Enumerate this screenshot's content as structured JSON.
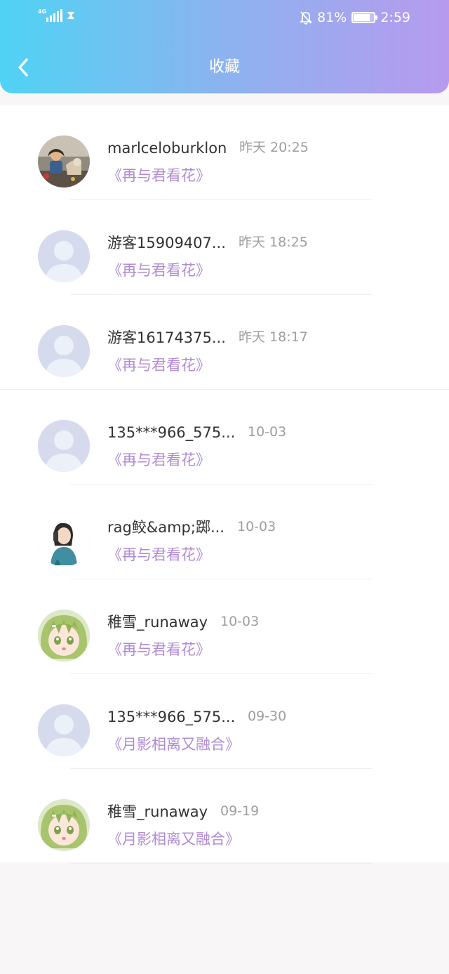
{
  "status_bar": {
    "network": "4G",
    "battery_percent": "81%",
    "battery_level": 0.81,
    "time": "2:59"
  },
  "header": {
    "title": "收藏"
  },
  "favorites": [
    {
      "name": "marlceloburklon",
      "time": "昨天 20:25",
      "book": "《再与君看花》",
      "avatar": "photo-child-with-dog"
    },
    {
      "name": "游客15909407...",
      "time": "昨天 18:25",
      "book": "《再与君看花》",
      "avatar": "default-avatar"
    },
    {
      "name": "游客16174375...",
      "time": "昨天 18:17",
      "book": "《再与君看花》",
      "avatar": "default-avatar"
    },
    {
      "name": "135***966_575...",
      "time": "10-03",
      "book": "《再与君看花》",
      "avatar": "default-avatar"
    },
    {
      "name": "rag鲛&amp;踯...",
      "time": "10-03",
      "book": "《再与君看花》",
      "avatar": "illustrated-girl-phone"
    },
    {
      "name": "稚雪_runaway",
      "time": "10-03",
      "book": "《再与君看花》",
      "avatar": "anime-green-hair"
    },
    {
      "name": "135***966_575...",
      "time": "09-30",
      "book": "《月影相离又融合》",
      "avatar": "default-avatar"
    },
    {
      "name": "稚雪_runaway",
      "time": "09-19",
      "book": "《月影相离又融合》",
      "avatar": "anime-green-hair"
    }
  ],
  "colors": {
    "header_start": "#4fd3f4",
    "header_end": "#b79aee",
    "book_title": "#b08bd4",
    "time_text": "#9e9e9e"
  }
}
